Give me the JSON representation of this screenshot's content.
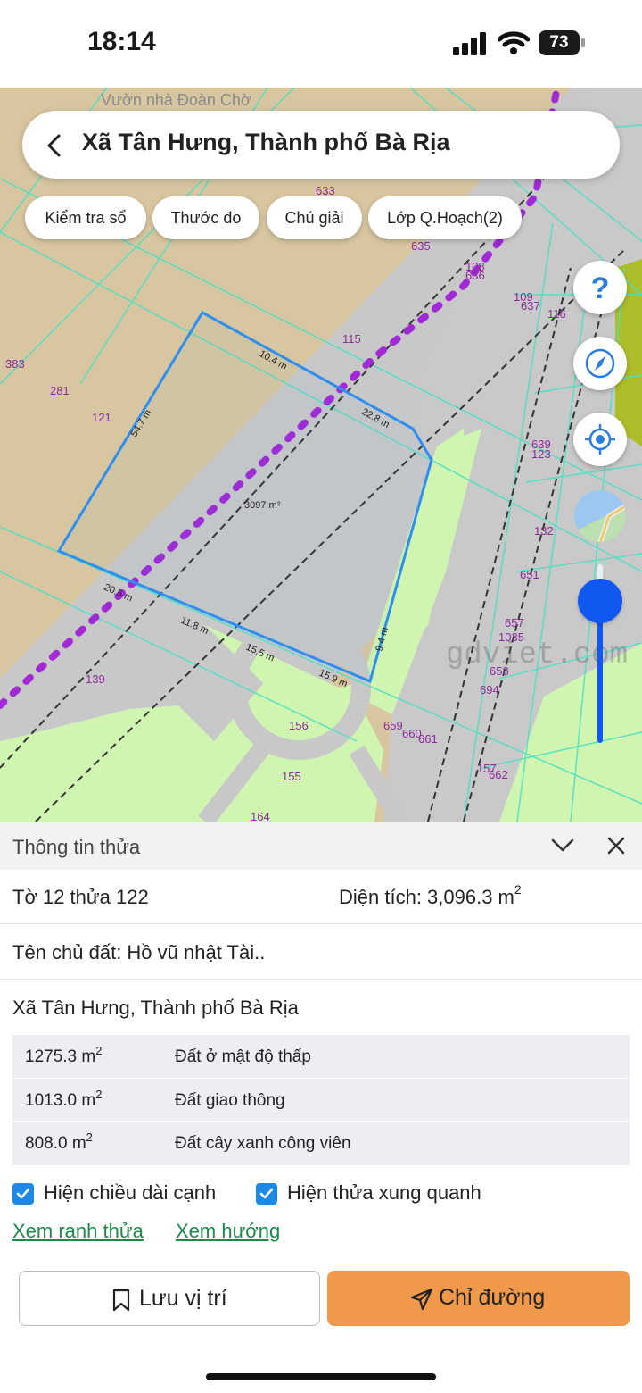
{
  "status": {
    "time": "18:14",
    "battery": "73"
  },
  "search": {
    "title": "Xã Tân Hưng, Thành phố Bà Rịa"
  },
  "chips": [
    "Kiểm tra sổ",
    "Thước đo",
    "Chú giải",
    "Lớp Q.Hoạch(2)"
  ],
  "map": {
    "parcel_area": "3097 m²",
    "edge_lengths": [
      "54.7 m",
      "10.4 m",
      "22.8 m",
      "20.5 m",
      "11.8 m",
      "15.5 m",
      "15.9 m",
      "9.4 m"
    ],
    "lot_numbers": [
      "383",
      "281",
      "121",
      "115",
      "635",
      "108",
      "636",
      "109",
      "637",
      "116",
      "639",
      "123",
      "132",
      "651",
      "657",
      "1035",
      "658",
      "694",
      "659",
      "660",
      "661",
      "139",
      "156",
      "155",
      "164",
      "157",
      "662",
      "633"
    ],
    "street_labels": [
      "Vườn nhà Đoàn Chờ"
    ],
    "watermark": "gdviet.com",
    "layer_colors": {
      "residential": "#d8c6a0",
      "road": "#c9c9c9",
      "park": "#cff5b0",
      "boundary": "#2f8ff0",
      "planning": "#a22ad6",
      "lot_line": "#4de0c4"
    }
  },
  "sheet": {
    "title": "Thông tin thửa",
    "parcel": "Tờ 12 thửa 122",
    "area_label": "Diện tích: 3,096.3 m",
    "area_sup": "2",
    "owner": "Tên chủ đất: Hồ vũ nhật Tài..",
    "address": "Xã Tân Hưng, Thành phố Bà Rịa",
    "land_use": [
      {
        "area": "1275.3 m",
        "type": "Đất ở mật độ thấp"
      },
      {
        "area": "1013.0 m",
        "type": "Đất giao thông"
      },
      {
        "area": "808.0 m",
        "type": "Đất cây xanh công viên"
      }
    ],
    "checkbox_edges": "Hiện chiều dài cạnh",
    "checkbox_nearby": "Hiện thửa xung quanh",
    "link_boundary": "Xem ranh thửa",
    "link_direction": "Xem hướng",
    "save_label": "Lưu vị trí",
    "direction_label": "Chỉ đường"
  },
  "zoom_level": 0.8
}
